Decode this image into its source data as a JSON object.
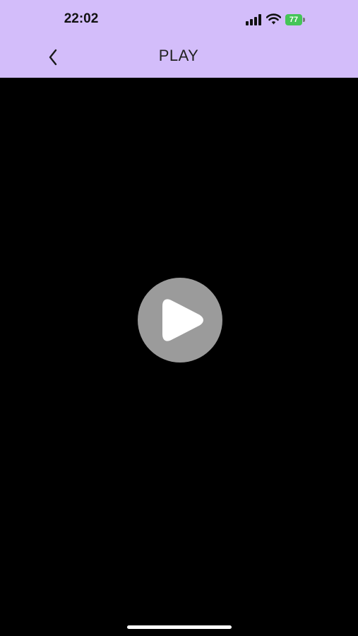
{
  "status_bar": {
    "time": "22:02",
    "battery_level": "77",
    "signal_icon": "cellular-signal-icon",
    "wifi_icon": "wifi-icon",
    "battery_color": "#44c557"
  },
  "header": {
    "title": "PLAY",
    "back_icon": "chevron-left-icon",
    "background_color": "#d3bdfa"
  },
  "player": {
    "play_icon": "play-icon",
    "background_color": "#000000"
  }
}
